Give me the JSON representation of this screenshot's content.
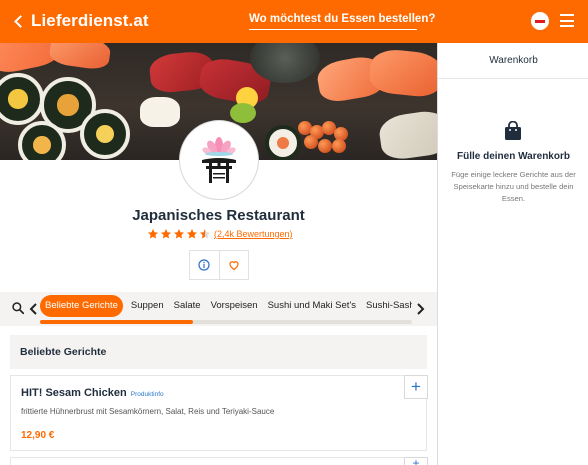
{
  "header": {
    "brand": "Lieferdienst.at",
    "address_prompt": "Wo möchtest du Essen bestellen?",
    "colors": {
      "brand_orange": "#ff6a00",
      "badge_red": "#e41b1b"
    }
  },
  "restaurant": {
    "name": "Japanisches Restaurant",
    "rating": 4.5,
    "rating_max": 5,
    "reviews_label": "(2,4k Bewertungen)"
  },
  "categories": {
    "items": [
      "Beliebte Gerichte",
      "Suppen",
      "Salate",
      "Vorspeisen",
      "Sushi und Maki Set's",
      "Sushi-Sashimi Se"
    ],
    "active_index": 0,
    "scroll_fraction": 0.41
  },
  "menu": {
    "section_title": "Beliebte Gerichte",
    "dishes": [
      {
        "name": "HIT! Sesam Chicken",
        "info_link": "Produktinfo",
        "description": "frittierte Hühnerbrust mit Sesamkörnern, Salat, Reis und Teriyaki-Sauce",
        "price": "12,90 €",
        "add_label": "+"
      }
    ]
  },
  "cart": {
    "title": "Warenkorb",
    "empty_title": "Fülle deinen Warenkorb",
    "empty_text": "Füge einige leckere Gerichte aus der Speisekarte hinzu und bestelle dein Essen."
  },
  "icons": {
    "back": "chevron-left-icon",
    "account": "minus-circle-icon",
    "menu": "hamburger-icon",
    "search": "search-icon",
    "info": "info-icon",
    "favorite": "heart-icon",
    "cart": "shopping-bag-icon"
  }
}
